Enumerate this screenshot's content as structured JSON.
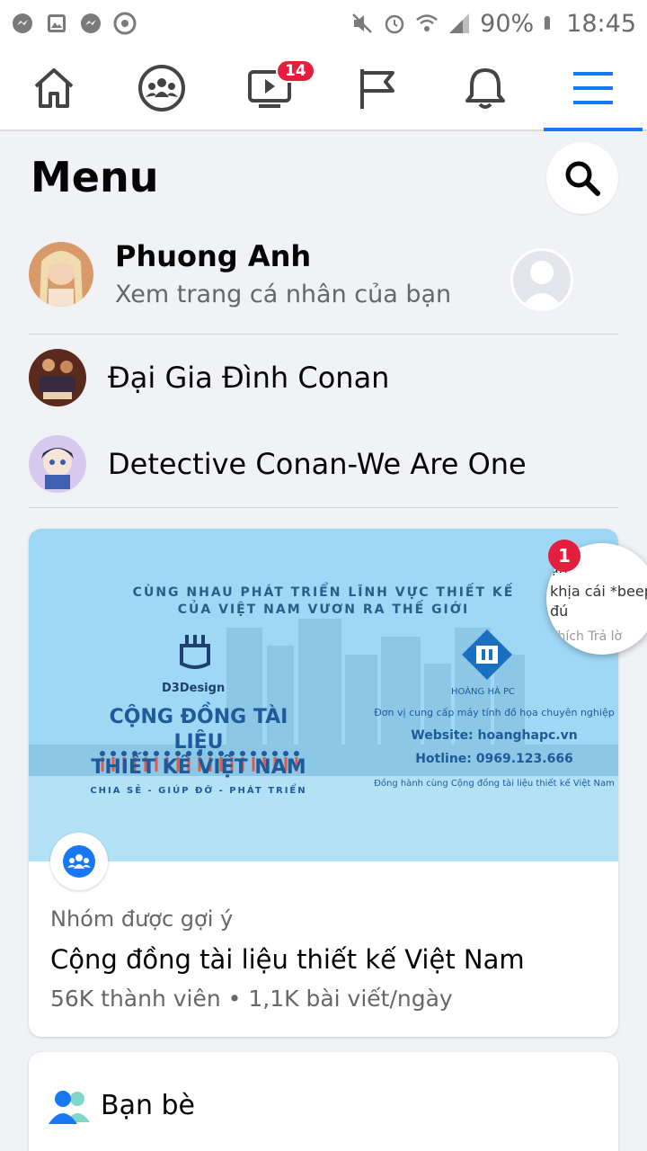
{
  "status_bar": {
    "battery": "90%",
    "time": "18:45"
  },
  "nav": {
    "watch_badge": "14"
  },
  "menu": {
    "title": "Menu"
  },
  "profile": {
    "name": "Phuong Anh",
    "subtitle": "Xem trang cá nhân của bạn"
  },
  "shortcuts": [
    {
      "name": "Đại Gia Đình Conan"
    },
    {
      "name": "Detective Conan-We Are One"
    }
  ],
  "suggested": {
    "banner": {
      "tagline_1": "CÙNG NHAU PHÁT TRIỂN LĨNH VỰC THIẾT KẾ",
      "tagline_2": "CỦA VIỆT NAM VƯƠN RA THẾ GIỚI",
      "brand_left": "D3Design",
      "headline_1": "CỘNG ĐỒNG TÀI LIỆU",
      "headline_2": "THIẾT KẾ VIỆT NAM",
      "motto": "CHIA SẺ - GIÚP ĐỠ - PHÁT TRIỂN",
      "brand_right": "HOÀNG HÀ PC",
      "provider": "Đơn vị cung cấp máy tính đồ họa chuyên nghiệp",
      "website": "Website: hoanghapc.vn",
      "hotline": "Hotline: 0969.123.666",
      "partner": "Đồng hành cùng Cộng đồng tài liệu thiết kế Việt Nam"
    },
    "label": "Nhóm được gợi ý",
    "name": "Cộng đồng tài liệu thiết kế Việt Nam",
    "meta": "56K thành viên • 1,1K bài viết/ngày"
  },
  "chat_bubble": {
    "count": "1",
    "line_1": "ạn",
    "line_2": "khịa cái *beep",
    "line_3": "đú",
    "line_4": "Thích   Trả lờ"
  },
  "friends": {
    "label": "Bạn bè"
  },
  "colors": {
    "accent": "#1877f2",
    "badge": "#e41e3f",
    "banner": "#9fd8f4"
  }
}
